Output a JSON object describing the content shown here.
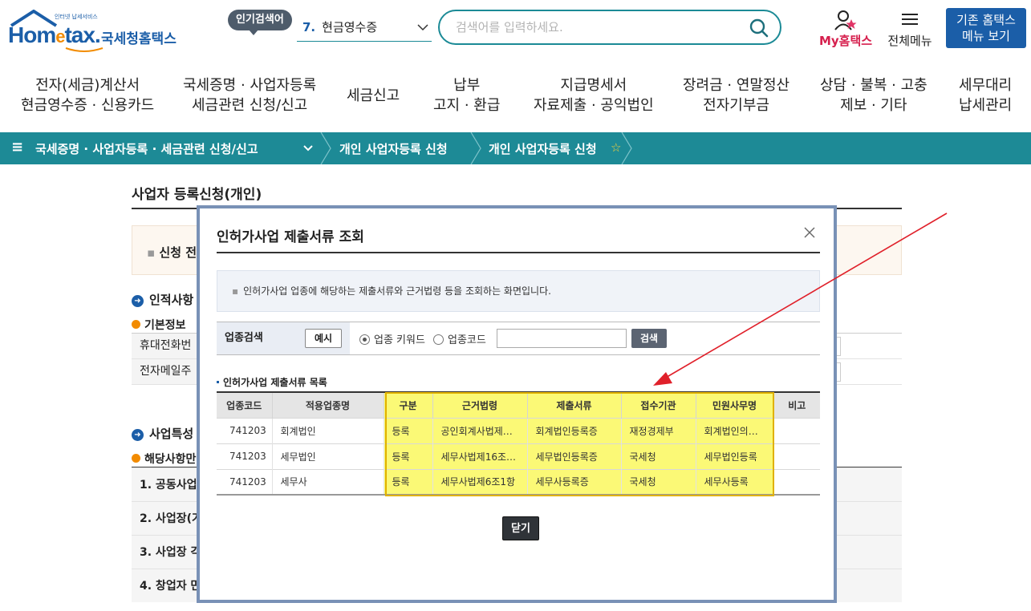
{
  "header": {
    "logo_tiny": "인터넷 납세서비스",
    "logo_en_1": "Hom",
    "logo_en_2": "e",
    "logo_en_3": "tax.",
    "logo_ko": "국세청홈택스",
    "popular_label": "인기검색어",
    "popular_num": "7.",
    "popular_value": "현금영수증",
    "search_placeholder": "검색어를 입력하세요.",
    "my_label": "My홈택스",
    "all_menu_label": "전체메뉴",
    "old_home_line1": "기존 홈택스",
    "old_home_line2": "메뉴 보기"
  },
  "nav": [
    {
      "line1": "전자(세금)계산서",
      "line2": "현금영수증 · 신용카드"
    },
    {
      "line1": "국세증명 · 사업자등록",
      "line2": "세금관련 신청/신고"
    },
    {
      "line1": "세금신고",
      "line2": ""
    },
    {
      "line1": "납부",
      "line2": "고지 · 환급"
    },
    {
      "line1": "지급명세서",
      "line2": "자료제출 · 공익법인"
    },
    {
      "line1": "장려금 · 연말정산",
      "line2": "전자기부금"
    },
    {
      "line1": "상담 · 불복 · 고충",
      "line2": "제보 · 기타"
    },
    {
      "line1": "세무대리",
      "line2": "납세관리"
    }
  ],
  "breadcrumb": {
    "item1": "국세증명 · 사업자등록 · 세금관련 신청/신고",
    "item2": "개인 사업자등록 신청",
    "item3": "개인 사업자등록 신청"
  },
  "page": {
    "title": "사업자 등록신청(개인)",
    "notice": "신청 전",
    "section1": "인적사항",
    "sub1": "기본정보",
    "row1": "휴대전화번",
    "row2": "전자메일주",
    "section2": "사업특성",
    "sub2": "해당사항만",
    "list": [
      "1. 공동사업",
      "2. 사업장(가",
      "3. 사업장 각",
      "4. 창업자 만"
    ]
  },
  "modal": {
    "title": "인허가사업 제출서류 조회",
    "info": "인허가사업 업종에 해당하는 제출서류와 근거법령 등을 조회하는 화면입니다.",
    "search_label": "업종검색",
    "example_btn": "예시",
    "radio_keyword": "업종 키워드",
    "radio_code": "업종코드",
    "search_btn": "검색",
    "list_title": "인허가사업 제출서류 목록",
    "columns": [
      "업종코드",
      "적용업종명",
      "구분",
      "근거법령",
      "제출서류",
      "접수기관",
      "민원사무명",
      "비고"
    ],
    "rows": [
      [
        "741203",
        "회계법인",
        "등록",
        "공인회계사법제…",
        "회계법인등록증",
        "재정경제부",
        "회계법인의…",
        ""
      ],
      [
        "741203",
        "세무법인",
        "등록",
        "세무사법제16조…",
        "세무법인등록증",
        "국세청",
        "세무법인등록",
        ""
      ],
      [
        "741203",
        "세무사",
        "등록",
        "세무사법제6조1항",
        "세무사등록증",
        "국세청",
        "세무사등록",
        ""
      ]
    ],
    "close_btn": "닫기"
  },
  "colors": {
    "brand": "#1b5ea8",
    "teal": "#1d8a96",
    "highlight": "#fbf976",
    "annotation": "#e0202a"
  }
}
